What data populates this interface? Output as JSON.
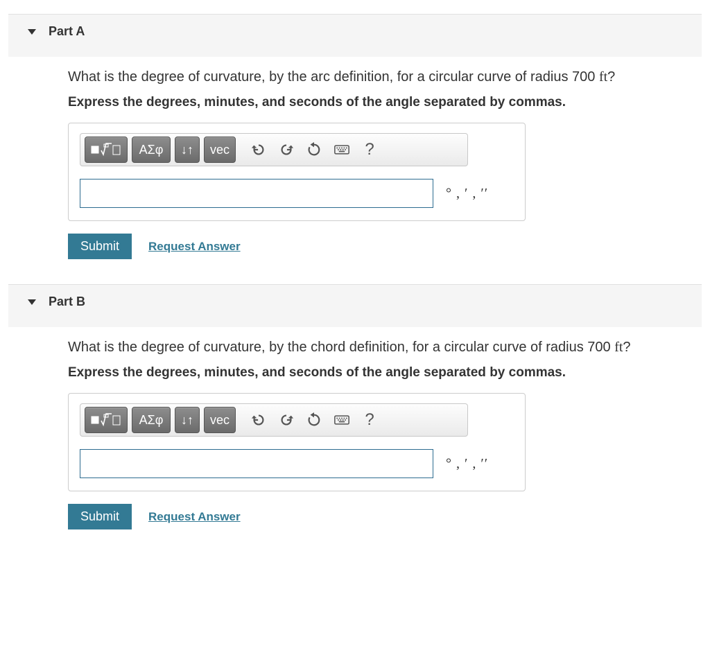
{
  "toolbar_labels": {
    "greek": "ΑΣφ",
    "updown": "↓↑",
    "vec": "vec",
    "undo_title": "Undo",
    "redo_title": "Redo",
    "reset_title": "Reset",
    "keyboard_title": "Keyboard",
    "help": "?"
  },
  "buttons": {
    "submit": "Submit",
    "request": "Request Answer"
  },
  "units_suffix": "° , ′ , ′′",
  "parts": [
    {
      "key": "A",
      "title": "Part A",
      "prompt_pre": "What is the degree of curvature, by the arc definition, for a circular curve of radius 700 ",
      "prompt_unit": "ft",
      "prompt_post": "?",
      "instruction": "Express the degrees, minutes, and seconds of the angle separated by commas.",
      "value": ""
    },
    {
      "key": "B",
      "title": "Part B",
      "prompt_pre": "What is the degree of curvature, by the chord definition, for a circular curve of radius 700 ",
      "prompt_unit": "ft",
      "prompt_post": "?",
      "instruction": "Express the degrees, minutes, and seconds of the angle separated by commas.",
      "value": ""
    }
  ]
}
